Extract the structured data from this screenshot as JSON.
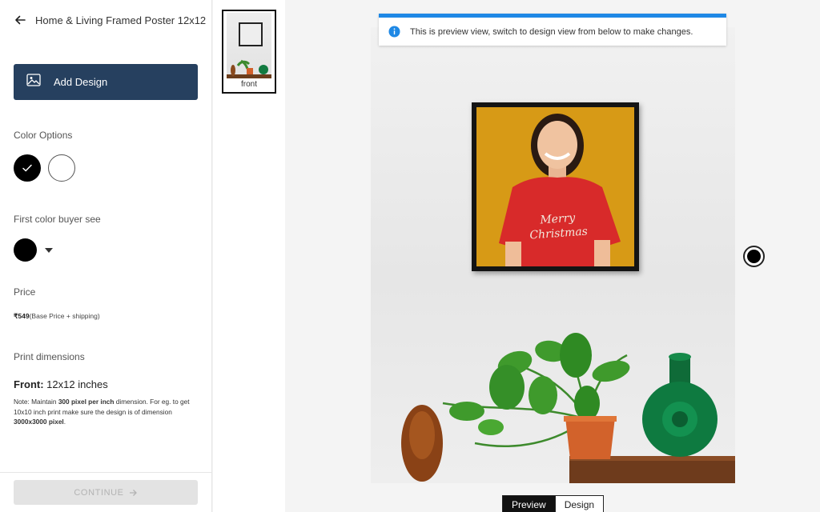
{
  "header": {
    "title": "Home & Living Framed Poster 12x12"
  },
  "actions": {
    "add_design_label": "Add Design",
    "continue_label": "CONTINUE"
  },
  "color_options": {
    "label": "Color Options",
    "swatches": [
      {
        "name": "black",
        "color": "#000000",
        "selected": true
      },
      {
        "name": "white",
        "color": "#ffffff",
        "selected": false
      }
    ]
  },
  "first_color": {
    "label": "First color buyer see",
    "value_color": "#000000"
  },
  "price": {
    "label": "Price",
    "amount": "₹549",
    "note": "(Base Price + shipping)"
  },
  "print_dimensions": {
    "label": "Print dimensions",
    "front_label": "Front:",
    "front_value": " 12x12 inches",
    "note_prefix": "Note: Maintain ",
    "note_bold1": "300 pixel per inch",
    "note_mid": " dimension. For eg. to get 10x10 inch print make sure the design is of dimension ",
    "note_bold2": "3000x3000 pixel",
    "note_end": "."
  },
  "thumbnails": [
    {
      "label": "front"
    }
  ],
  "info_banner": {
    "text": "This is preview view, switch to design view from below to make changes."
  },
  "poster": {
    "shirt_text_line1": "Merry",
    "shirt_text_line2": "Christmas"
  },
  "view_tabs": {
    "preview_label": "Preview",
    "design_label": "Design",
    "active": "Preview"
  },
  "colors": {
    "accent": "#26405f",
    "info": "#1e88e5",
    "poster_bg": "#d79a16",
    "shirt": "#d82a2a"
  }
}
